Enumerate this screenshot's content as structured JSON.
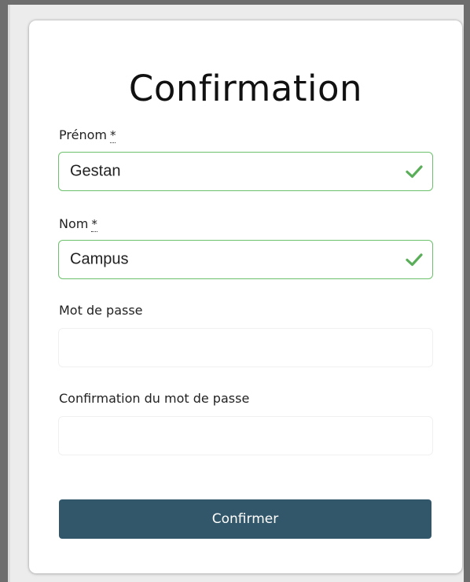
{
  "form": {
    "title": "Confirmation",
    "required_marker": "*",
    "fields": [
      {
        "label": "Prénom",
        "value": "Gestan",
        "required": true,
        "status": "valid"
      },
      {
        "label": "Nom",
        "value": "Campus",
        "required": true,
        "status": "valid"
      },
      {
        "label": "Mot de passe",
        "value": "",
        "required": false,
        "status": "empty"
      },
      {
        "label": "Confirmation du mot de passe",
        "value": "",
        "required": false,
        "status": "empty"
      }
    ],
    "submit_label": "Confirmer"
  },
  "colors": {
    "valid_border": "#6cc26c",
    "valid_check": "#5aae5a",
    "button_bg": "#33576a",
    "button_text": "#ffffff"
  },
  "icons": {
    "valid": "check-icon"
  }
}
